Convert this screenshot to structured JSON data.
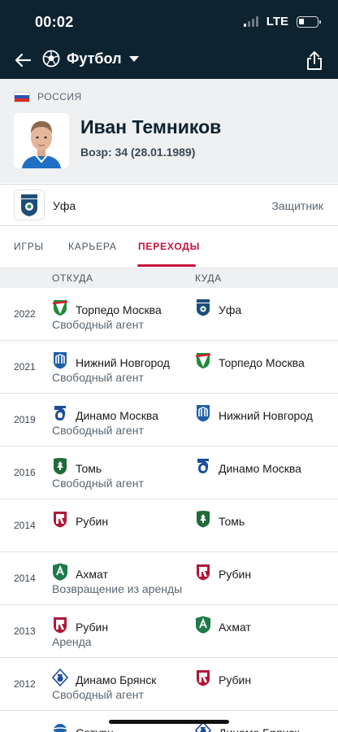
{
  "status_bar": {
    "time": "00:02",
    "network": "LTE",
    "battery_level": 0.3
  },
  "nav": {
    "sport_label": "Футбол",
    "back_icon": "arrow-left-icon",
    "sport_icon": "soccer-ball-icon",
    "dropdown_icon": "caret-down-icon",
    "share_icon": "share-icon"
  },
  "player": {
    "country": "РОССИЯ",
    "name": "Иван Темников",
    "age_line": "Возр: 34 (28.01.1989)",
    "team": "Уфа",
    "position": "Защитник"
  },
  "tabs": [
    {
      "label": "ИГРЫ",
      "active": false
    },
    {
      "label": "КАРЬЕРА",
      "active": false
    },
    {
      "label": "ПЕРЕХОДЫ",
      "active": true
    }
  ],
  "columns": {
    "from": "ОТКУДА",
    "to": "КУДА"
  },
  "colors": {
    "header_bg": "#0d2330",
    "accent": "#c8103e"
  },
  "transfers": [
    {
      "year": "2022",
      "from": "Торпедо Москва",
      "from_crest": "torpedo",
      "to": "Уфа",
      "to_crest": "ufa",
      "type": "Свободный агент"
    },
    {
      "year": "2021",
      "from": "Нижний Новгород",
      "from_crest": "nn",
      "to": "Торпедо Москва",
      "to_crest": "torpedo",
      "type": "Свободный агент"
    },
    {
      "year": "2019",
      "from": "Динамо Москва",
      "from_crest": "dinamo",
      "to": "Нижний Новгород",
      "to_crest": "nn",
      "type": "Свободный агент"
    },
    {
      "year": "2016",
      "from": "Томь",
      "from_crest": "tom",
      "to": "Динамо Москва",
      "to_crest": "dinamo",
      "type": "Свободный агент"
    },
    {
      "year": "2014",
      "from": "Рубин",
      "from_crest": "rubin",
      "to": "Томь",
      "to_crest": "tom",
      "type": ""
    },
    {
      "year": "2014",
      "from": "Ахмат",
      "from_crest": "akhmat",
      "to": "Рубин",
      "to_crest": "rubin",
      "type": "Возвращение из аренды"
    },
    {
      "year": "2013",
      "from": "Рубин",
      "from_crest": "rubin",
      "to": "Ахмат",
      "to_crest": "akhmat",
      "type": "Аренда"
    },
    {
      "year": "2012",
      "from": "Динамо Брянск",
      "from_crest": "dinamo-bryansk",
      "to": "Рубин",
      "to_crest": "rubin",
      "type": "Свободный агент"
    },
    {
      "year": "",
      "from": "Сатурн",
      "from_crest": "saturn",
      "to": "Динамо Брянск",
      "to_crest": "dinamo-bryansk",
      "type": ""
    }
  ]
}
